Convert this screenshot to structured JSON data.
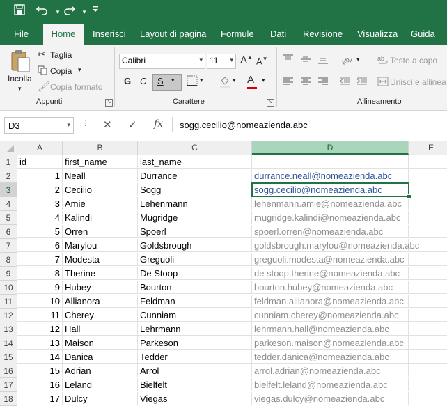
{
  "qat": {
    "save_icon": "save-icon",
    "undo_icon": "undo-icon",
    "redo_icon": "redo-icon",
    "customize_icon": "customize-qat-icon"
  },
  "tabs": [
    "File",
    "Home",
    "Inserisci",
    "Layout di pagina",
    "Formule",
    "Dati",
    "Revisione",
    "Visualizza",
    "Guida"
  ],
  "active_tab": "Home",
  "ribbon": {
    "clipboard": {
      "paste": "Incolla",
      "cut": "Taglia",
      "copy": "Copia",
      "format_painter": "Copia formato",
      "group": "Appunti"
    },
    "font": {
      "name": "Calibri",
      "size": "11",
      "bold": "G",
      "italic": "C",
      "underline": "S",
      "group": "Carattere"
    },
    "alignment": {
      "wrap": "Testo a capo",
      "merge": "Unisci e allinea",
      "group": "Allineamento"
    }
  },
  "formula_bar": {
    "name_box": "D3",
    "formula": "sogg.cecilio@nomeazienda.abc"
  },
  "columns": [
    "A",
    "B",
    "C",
    "D",
    "E"
  ],
  "selected_column": "D",
  "selected_row": "3",
  "rows": [
    {
      "n": "1",
      "a": "id",
      "b": "first_name",
      "c": "last_name",
      "d": ""
    },
    {
      "n": "2",
      "a": "1",
      "b": "Neall",
      "c": "Durrance",
      "d": "durrance.neall@nomeazienda.abc"
    },
    {
      "n": "3",
      "a": "2",
      "b": "Cecilio",
      "c": "Sogg",
      "d": "sogg.cecilio@nomeazienda.abc"
    },
    {
      "n": "4",
      "a": "3",
      "b": "Amie",
      "c": "Lehenmann",
      "d": "lehenmann.amie@nomeazienda.abc"
    },
    {
      "n": "5",
      "a": "4",
      "b": "Kalindi",
      "c": "Mugridge",
      "d": "mugridge.kalindi@nomeazienda.abc"
    },
    {
      "n": "6",
      "a": "5",
      "b": "Orren",
      "c": "Spoerl",
      "d": "spoerl.orren@nomeazienda.abc"
    },
    {
      "n": "7",
      "a": "6",
      "b": "Marylou",
      "c": "Goldsbrough",
      "d": "goldsbrough.marylou@nomeazienda.abc"
    },
    {
      "n": "8",
      "a": "7",
      "b": "Modesta",
      "c": "Greguoli",
      "d": "greguoli.modesta@nomeazienda.abc"
    },
    {
      "n": "9",
      "a": "8",
      "b": "Therine",
      "c": "De Stoop",
      "d": "de stoop.therine@nomeazienda.abc"
    },
    {
      "n": "10",
      "a": "9",
      "b": "Hubey",
      "c": "Bourton",
      "d": "bourton.hubey@nomeazienda.abc"
    },
    {
      "n": "11",
      "a": "10",
      "b": "Allianora",
      "c": "Feldman",
      "d": "feldman.allianora@nomeazienda.abc"
    },
    {
      "n": "12",
      "a": "11",
      "b": "Cherey",
      "c": "Cunniam",
      "d": "cunniam.cherey@nomeazienda.abc"
    },
    {
      "n": "13",
      "a": "12",
      "b": "Hall",
      "c": "Lehrmann",
      "d": "lehrmann.hall@nomeazienda.abc"
    },
    {
      "n": "14",
      "a": "13",
      "b": "Maison",
      "c": "Parkeson",
      "d": "parkeson.maison@nomeazienda.abc"
    },
    {
      "n": "15",
      "a": "14",
      "b": "Danica",
      "c": "Tedder",
      "d": "tedder.danica@nomeazienda.abc"
    },
    {
      "n": "16",
      "a": "15",
      "b": "Adrian",
      "c": "Arrol",
      "d": "arrol.adrian@nomeazienda.abc"
    },
    {
      "n": "17",
      "a": "16",
      "b": "Leland",
      "c": "Bielfelt",
      "d": "bielfelt.leland@nomeazienda.abc"
    },
    {
      "n": "18",
      "a": "17",
      "b": "Dulcy",
      "c": "Viegas",
      "d": "viegas.dulcy@nomeazienda.abc"
    }
  ],
  "colors": {
    "accent": "#217346",
    "link": "#2f5597",
    "flash_fill_preview": "#8e8e8e"
  }
}
